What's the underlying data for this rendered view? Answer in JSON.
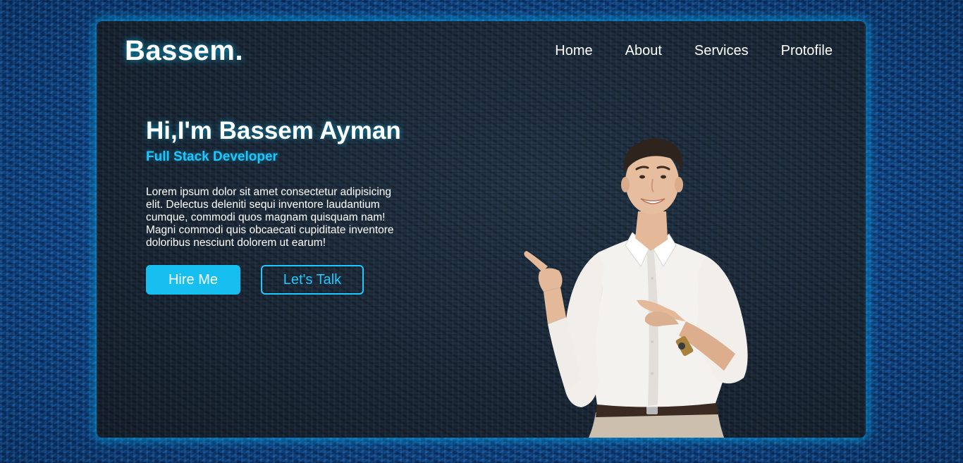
{
  "logo": {
    "text": "Bassem."
  },
  "nav": {
    "items": [
      {
        "label": "Home"
      },
      {
        "label": "About"
      },
      {
        "label": "Services"
      },
      {
        "label": "Protofile"
      }
    ]
  },
  "hero": {
    "headline": "Hi,I'm Bassem Ayman",
    "subtitle": "Full Stack Developer",
    "description": "Lorem ipsum dolor sit amet consectetur adipisicing elit. Delectus deleniti sequi inventore laudantium cumque, commodi quos magnam quisquam nam! Magni commodi quis obcaecati cupiditate inventore doloribus nesciunt dolorem ut earum!",
    "primary_button": "Hire Me",
    "secondary_button": "Let's Talk"
  },
  "colors": {
    "accent": "#1ec8ff",
    "card_background": "#1c2733",
    "page_background": "#0f4686",
    "text": "#ffffff"
  }
}
